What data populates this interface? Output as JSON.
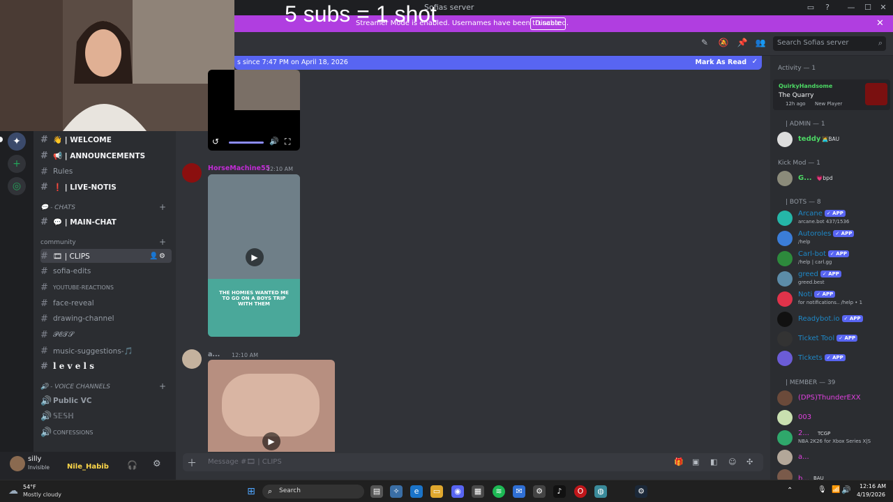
{
  "window": {
    "title": "Sofias server"
  },
  "overlay": {
    "text": "5 subs = 1 shot"
  },
  "banner": {
    "message": "Streamer Mode is enabled. Usernames have been truncated.",
    "disable_label": "Disable"
  },
  "header": {
    "search_placeholder": "Search Sofias server"
  },
  "new_messages": {
    "text": "s since 7:47 PM on April 18, 2026",
    "mark_read": "Mark As Read"
  },
  "sidebar": {
    "channels": [
      {
        "label": "👋 | WELCOME"
      },
      {
        "label": "📢 | ANNOUNCEMENTS"
      },
      {
        "label": "Rules"
      },
      {
        "label": "❗ | LIVE-NOTIS"
      },
      {
        "label": "💬 | MAIN-CHAT"
      },
      {
        "label": "🎞 | CLIPS"
      },
      {
        "label": "sofia-edits"
      },
      {
        "label": "YOUTUBE-REACTIONS"
      },
      {
        "label": "face-reveal"
      },
      {
        "label": "drawing-channel"
      },
      {
        "label": "𝓟𝓔𝓣𝓢"
      },
      {
        "label": "music-suggestions-🎵"
      },
      {
        "label": "l e v e l s"
      }
    ],
    "categories": {
      "chats": "💬 - CHATS",
      "community": "community",
      "voice": "🔊 - VOICE CHANNELS"
    },
    "voice": [
      {
        "label": "Public VC"
      },
      {
        "label": "𝕊𝔼𝕊ℍ"
      },
      {
        "label": "CONFESSIONS"
      }
    ]
  },
  "user": {
    "name": "silly",
    "status": "Invisible",
    "overlay_name": "Nile_Habib"
  },
  "chat": {
    "messages": [
      {
        "author": "HorseMachine55",
        "time": "12:10 AM",
        "color": "#c22bd6",
        "caption": "THE HOMIES WANTED ME TO GO ON A BOYS TRIP WITH THEM"
      },
      {
        "author": "a...",
        "time": "12:10 AM",
        "color": "#949ba4"
      }
    ],
    "composer_placeholder": "Message #🎞 | CLIPS"
  },
  "members": {
    "activity_header": "Activity — 1",
    "activity": {
      "name": "QuirkyHandsome",
      "game": "The Quarry",
      "meta": "12h ago",
      "tag": "New Player"
    },
    "sections": [
      {
        "title": "| ADMIN — 1",
        "items": [
          {
            "name": "teddy",
            "tag": "🧑‍💻BAU",
            "color": "#4cd964"
          }
        ]
      },
      {
        "title": "Kick Mod — 1",
        "items": [
          {
            "name": "G...",
            "tag": "💗bpd",
            "color": "#4cd964"
          }
        ]
      },
      {
        "title": "| BOTS — 8",
        "items": [
          {
            "name": "Arcane",
            "status": "arcane.bot 437/1536",
            "color": "#1e88c7",
            "app": "✓ APP"
          },
          {
            "name": "Autoroles",
            "status": "/help",
            "color": "#1e88c7",
            "app": "✓ APP"
          },
          {
            "name": "Carl-bot",
            "status": "/help | carl.gg",
            "color": "#1e88c7",
            "app": "✓ APP"
          },
          {
            "name": "greed",
            "status": "greed.best",
            "color": "#1e88c7",
            "app": "✓ APP"
          },
          {
            "name": "Noti",
            "status": "for notifications.. /help • 1",
            "color": "#1e88c7",
            "app": "✓ APP"
          },
          {
            "name": "Readybot.io",
            "status": "",
            "color": "#1e88c7",
            "app": "✓ APP"
          },
          {
            "name": "Ticket Tool",
            "status": "",
            "color": "#1e88c7",
            "app": "✓ APP"
          },
          {
            "name": "Tickets",
            "status": "",
            "color": "#1e88c7",
            "app": "✓ APP"
          }
        ]
      },
      {
        "title": "| MEMBER — 39",
        "items": [
          {
            "name": "(DPS)ThunderEXX",
            "status": "",
            "color": "#e040e0"
          },
          {
            "name": "003",
            "status": "",
            "color": "#e040e0"
          },
          {
            "name": "2...",
            "tag": "TCGP",
            "status": "NBA 2K26 for Xbox Series X|S",
            "color": "#e040e0"
          },
          {
            "name": "a...",
            "status": "",
            "color": "#e040e0"
          },
          {
            "name": "b...",
            "tag": "BAU",
            "status": "",
            "color": "#e040e0"
          }
        ]
      }
    ]
  },
  "taskbar": {
    "weather_temp": "54°F",
    "weather_desc": "Mostly cloudy",
    "search": "Search",
    "time": "12:16 AM",
    "date": "4/19/2026"
  },
  "colors": {
    "banner": "#b03ee0",
    "blurple": "#5865f2",
    "green": "#23a55a"
  }
}
